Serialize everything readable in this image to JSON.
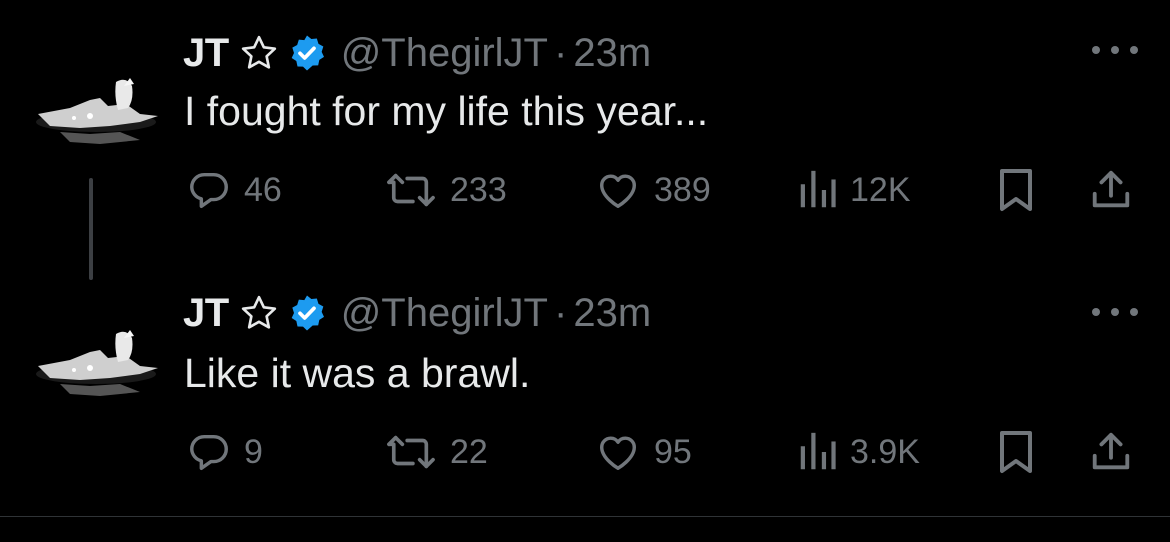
{
  "colors": {
    "background": "#000000",
    "text": "#e7e9ea",
    "secondary": "#71767b",
    "verified": "#1d9bf0"
  },
  "tweets": [
    {
      "name": "JT",
      "handle": "@ThegirlJT",
      "separator": "·",
      "time": "23m",
      "text": "I fought for my life this year...",
      "replies": "46",
      "retweets": "233",
      "likes": "389",
      "views": "12K"
    },
    {
      "name": "JT",
      "handle": "@ThegirlJT",
      "separator": "·",
      "time": "23m",
      "text": "Like it was a brawl.",
      "replies": "9",
      "retweets": "22",
      "likes": "95",
      "views": "3.9K"
    }
  ],
  "icons": {
    "star": "star-outline-icon",
    "verified": "verified-badge-icon",
    "more": "more-horizontal-icon",
    "reply": "reply-icon",
    "retweet": "retweet-icon",
    "like": "heart-icon",
    "views": "views-icon",
    "bookmark": "bookmark-icon",
    "share": "share-icon"
  }
}
